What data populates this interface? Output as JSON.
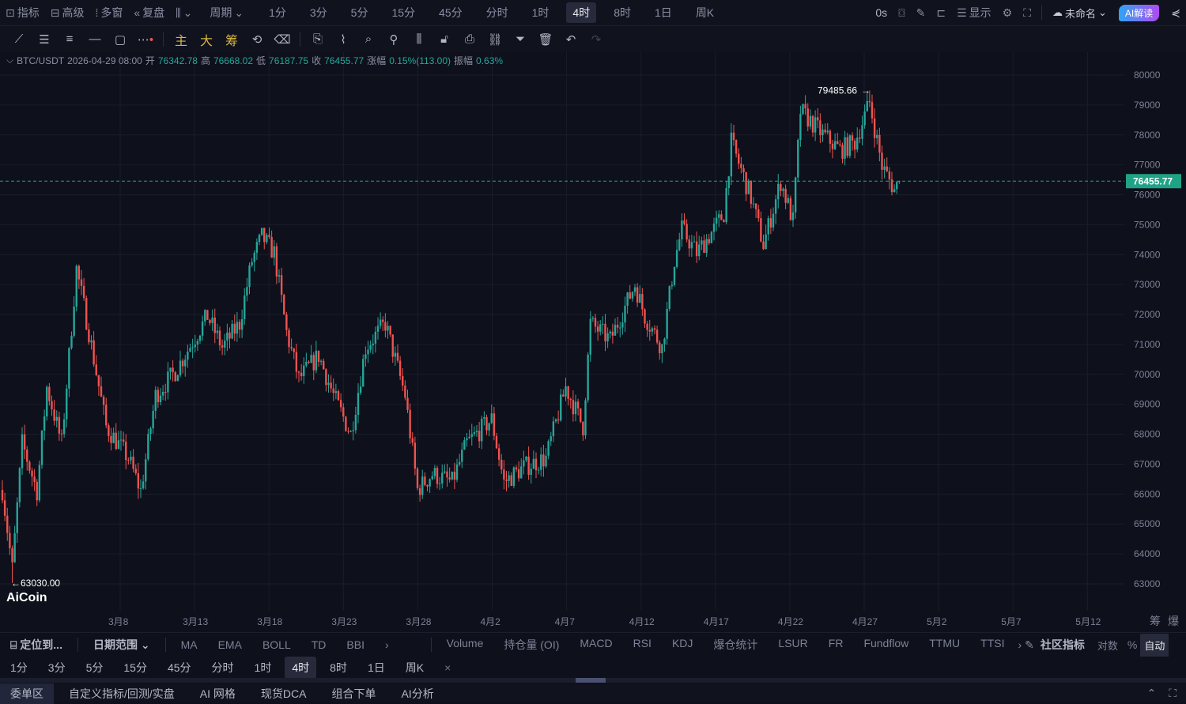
{
  "topbar": {
    "indicators": "指标",
    "advanced": "高级",
    "multi_window": "多窗",
    "replay": "复盘",
    "period": "周期",
    "periods": [
      "1分",
      "3分",
      "5分",
      "15分",
      "45分",
      "分时",
      "1时",
      "4时",
      "8时",
      "1日",
      "周K"
    ],
    "active_period": "4时",
    "countdown": "0s",
    "display": "显示",
    "layout_name": "未命名",
    "ai_button": "AI解读"
  },
  "toolbar": {
    "main": "主",
    "big": "大",
    "chips": "筹"
  },
  "info": {
    "pair": "BTC/USDT",
    "time": "2026-04-29 08:00",
    "open_label": "开",
    "open": "76342.78",
    "high_label": "高",
    "high": "76668.02",
    "low_label": "低",
    "low": "76187.75",
    "close_label": "收",
    "close": "76455.77",
    "change_label": "涨幅",
    "change": "0.15%(113.00)",
    "amp_label": "振幅",
    "amp": "0.63%"
  },
  "chart_data": {
    "type": "candlestick",
    "title": "BTC/USDT 4时",
    "y_ticks": [
      80000,
      79000,
      78000,
      77000,
      76000,
      75000,
      74000,
      73000,
      72000,
      71000,
      70000,
      69000,
      68000,
      67000,
      66000,
      65000,
      64000,
      63000
    ],
    "x_ticks": [
      "3月8",
      "3月13",
      "3月18",
      "3月23",
      "3月28",
      "4月2",
      "4月7",
      "4月12",
      "4月17",
      "4月22",
      "4月27",
      "5月2",
      "5月7",
      "5月12"
    ],
    "candle_count": 364,
    "last_price": "76455.77",
    "max_label": "79485.66",
    "min_label": "63030.00",
    "max": 79485.66,
    "min": 63030.0,
    "path": [
      [
        0,
        66140
      ],
      [
        4,
        63500
      ],
      [
        8,
        67700
      ],
      [
        14,
        66100
      ],
      [
        18,
        69570
      ],
      [
        24,
        67700
      ],
      [
        30,
        73530
      ],
      [
        35,
        71420
      ],
      [
        42,
        68250
      ],
      [
        51,
        67200
      ],
      [
        56,
        66100
      ],
      [
        62,
        69300
      ],
      [
        70,
        70100
      ],
      [
        83,
        71950
      ],
      [
        89,
        70900
      ],
      [
        96,
        71700
      ],
      [
        101,
        73800
      ],
      [
        105,
        74600
      ],
      [
        110,
        74060
      ],
      [
        115,
        71400
      ],
      [
        120,
        69840
      ],
      [
        128,
        70630
      ],
      [
        134,
        69300
      ],
      [
        141,
        68000
      ],
      [
        147,
        70900
      ],
      [
        155,
        71700
      ],
      [
        163,
        69300
      ],
      [
        168,
        66150
      ],
      [
        174,
        66670
      ],
      [
        182,
        66400
      ],
      [
        188,
        67700
      ],
      [
        198,
        68500
      ],
      [
        203,
        66400
      ],
      [
        211,
        66900
      ],
      [
        220,
        67200
      ],
      [
        228,
        69570
      ],
      [
        235,
        68250
      ],
      [
        238,
        71700
      ],
      [
        246,
        71150
      ],
      [
        256,
        73000
      ],
      [
        260,
        71950
      ],
      [
        267,
        70900
      ],
      [
        272,
        73800
      ],
      [
        275,
        74850
      ],
      [
        281,
        74060
      ],
      [
        288,
        74850
      ],
      [
        292,
        75380
      ],
      [
        295,
        77750
      ],
      [
        303,
        75900
      ],
      [
        308,
        74330
      ],
      [
        315,
        76440
      ],
      [
        320,
        75120
      ],
      [
        323,
        78800
      ],
      [
        326,
        78550
      ],
      [
        332,
        78020
      ],
      [
        339,
        77500
      ],
      [
        345,
        77750
      ],
      [
        351,
        79080
      ],
      [
        356,
        76960
      ],
      [
        361,
        76170
      ],
      [
        363,
        76455
      ]
    ],
    "colors": {
      "up": "#26a69a",
      "down": "#ef5350",
      "last": "#1fa386"
    }
  },
  "axis_extra": [
    "筹",
    "爆"
  ],
  "indicators": {
    "locate": "定位到...",
    "date_range": "日期范围",
    "main": [
      "MA",
      "EMA",
      "BOLL",
      "TD",
      "BBI"
    ],
    "sub": [
      "Volume",
      "持仓量 (OI)",
      "MACD",
      "RSI",
      "KDJ",
      "爆仓统计",
      "LSUR",
      "FR",
      "Fundflow",
      "TTMU",
      "TTSI"
    ],
    "community": "社区指标",
    "log": "对数",
    "percent": "%",
    "auto": "自动"
  },
  "period_bar": [
    "1分",
    "3分",
    "5分",
    "15分",
    "45分",
    "分时",
    "1时",
    "4时",
    "8时",
    "1日",
    "周K"
  ],
  "bottom_tabs": [
    "委单区",
    "自定义指标/回测/实盘",
    "AI 网格",
    "现货DCA",
    "组合下单",
    "AI分析"
  ],
  "logo": "AiCoin"
}
